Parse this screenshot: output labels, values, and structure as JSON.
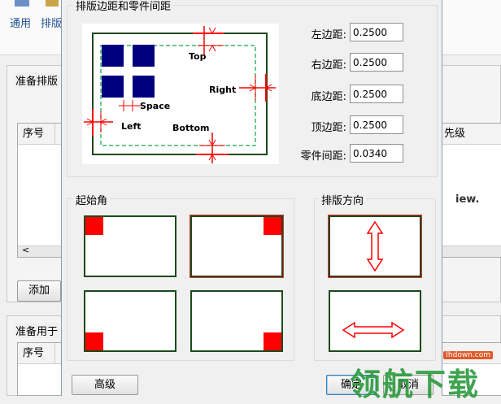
{
  "background_app": {
    "toolbar": {
      "general_label": "通用",
      "nest_label": "排版"
    },
    "panel_ready_nest": {
      "title": "准备排版",
      "columns": [
        "序号",
        "先级"
      ],
      "hint_fragment": "iew.",
      "add_button": "添加"
    },
    "panel_ready_use": {
      "title": "准备用于",
      "columns": [
        "序号"
      ]
    }
  },
  "dialog": {
    "margins_group": {
      "title": "排版边距和零件间距",
      "diagram": {
        "top": "Top",
        "right": "Right",
        "space": "Space",
        "left": "Left",
        "bottom": "Bottom"
      },
      "fields": [
        {
          "label": "左边距:",
          "value": "0.2500"
        },
        {
          "label": "右边距:",
          "value": "0.2500"
        },
        {
          "label": "底边距:",
          "value": "0.2500"
        },
        {
          "label": "顶边距:",
          "value": "0.2500"
        },
        {
          "label": "零件间距:",
          "value": "0.0340"
        }
      ]
    },
    "start_corner_group": {
      "title": "起始角",
      "options": [
        "top-left",
        "top-right",
        "bottom-left",
        "bottom-right"
      ],
      "selected": "top-right"
    },
    "direction_group": {
      "title": "排版方向",
      "options": [
        "vertical",
        "horizontal"
      ],
      "selected": "vertical"
    },
    "buttons": {
      "advanced": "高级",
      "ok": "确定",
      "cancel": "取消"
    }
  },
  "watermark": {
    "site": "lhdown.com",
    "text": "领航下载"
  },
  "colors": {
    "accent_red": "#ff0000",
    "part_navy": "#00007f",
    "frame_green": "#1c4a1c",
    "dash_green": "#3cb371"
  }
}
